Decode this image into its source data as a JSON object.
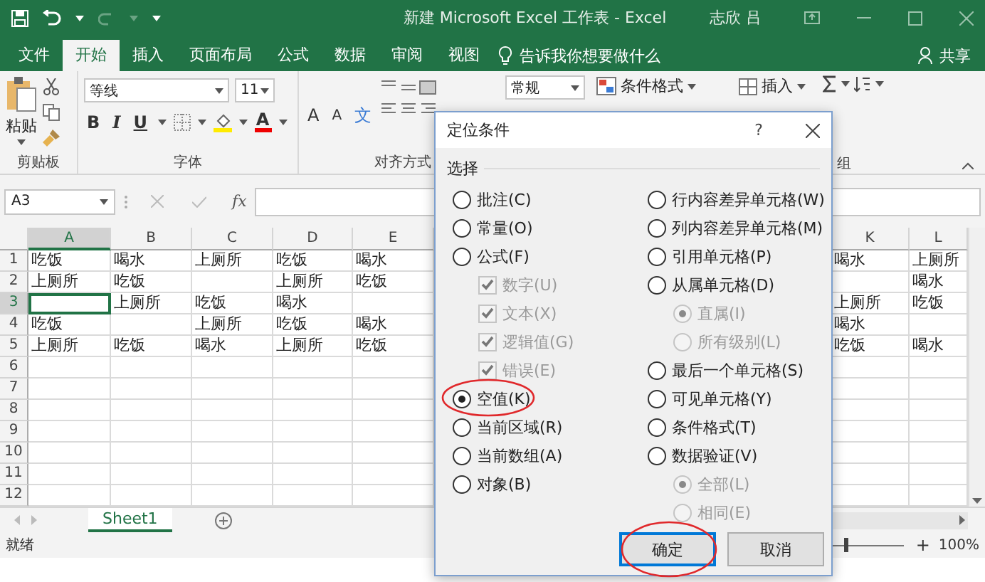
{
  "window": {
    "title": "新建 Microsoft Excel 工作表 - Excel",
    "user": "志欣 吕"
  },
  "ribbon_tabs": [
    {
      "label": "文件",
      "selected": false
    },
    {
      "label": "开始",
      "selected": true
    },
    {
      "label": "插入",
      "selected": false
    },
    {
      "label": "页面布局",
      "selected": false
    },
    {
      "label": "公式",
      "selected": false
    },
    {
      "label": "数据",
      "selected": false
    },
    {
      "label": "审阅",
      "selected": false
    },
    {
      "label": "视图",
      "selected": false
    }
  ],
  "tell_me": {
    "placeholder": "告诉我你想要做什么"
  },
  "share": "共享",
  "ribbon": {
    "paste": "粘贴",
    "font_name": "等线",
    "font_size": "11",
    "grow_font": "A",
    "shrink_font": "A",
    "font_styles": [
      "B",
      "I",
      "U"
    ],
    "font_color": "A",
    "phonetic": "文",
    "number_format": "常规",
    "conditional_format": "条件格式",
    "insert_cells": "插入",
    "group_labels": [
      "剪贴板",
      "字体",
      "对齐方式"
    ],
    "cut_label": "组"
  },
  "formula_bar": {
    "name_box": "A3",
    "function": "fx"
  },
  "sheet": {
    "columns": [
      {
        "label": "A",
        "selected": true
      },
      {
        "label": "B",
        "selected": false
      },
      {
        "label": "C",
        "selected": false
      },
      {
        "label": "D",
        "selected": false
      },
      {
        "label": "E",
        "selected": false
      }
    ],
    "right_columns": [
      "K",
      "L"
    ],
    "rows": [
      {
        "label": "1",
        "selected": false,
        "cells": [
          "吃饭",
          "喝水",
          "上厕所",
          "吃饭",
          "喝水"
        ],
        "right_cells": [
          "喝水",
          "上厕所"
        ]
      },
      {
        "label": "2",
        "selected": false,
        "cells": [
          "上厕所",
          "吃饭",
          null,
          "上厕所",
          "吃饭"
        ],
        "right_cells": [
          null,
          "喝水"
        ]
      },
      {
        "label": "3",
        "selected": true,
        "cells": [
          null,
          "上厕所",
          "吃饭",
          "喝水",
          null
        ],
        "right_cells": [
          "上厕所",
          "吃饭"
        ]
      },
      {
        "label": "4",
        "selected": false,
        "cells": [
          "吃饭",
          null,
          "上厕所",
          "吃饭",
          "喝水"
        ],
        "right_cells": [
          "喝水",
          null
        ]
      },
      {
        "label": "5",
        "selected": false,
        "cells": [
          "上厕所",
          "吃饭",
          "喝水",
          "上厕所",
          "吃饭"
        ],
        "right_cells": [
          "吃饭",
          "喝水"
        ]
      },
      {
        "label": "6",
        "selected": false
      },
      {
        "label": "7",
        "selected": false
      },
      {
        "label": "8",
        "selected": false
      },
      {
        "label": "9",
        "selected": false
      },
      {
        "label": "10",
        "selected": false
      },
      {
        "label": "11",
        "selected": false
      },
      {
        "label": "12",
        "selected": false
      }
    ]
  },
  "sheet_tabs": [
    {
      "label": "Sheet1",
      "selected": true
    }
  ],
  "status_bar": {
    "text": "就绪",
    "zoom_in": "+",
    "zoom": {
      "level": 0.5,
      "reading": "100%"
    }
  },
  "dialog": {
    "title": "定位条件",
    "help": "?",
    "group_label": "选择",
    "columns": [
      {
        "options": [
          {
            "kind": "radio",
            "label": "批注(C)",
            "selected": false,
            "disabled": false,
            "highlighted": false
          },
          {
            "kind": "radio",
            "label": "常量(O)",
            "selected": false,
            "disabled": false,
            "highlighted": false
          },
          {
            "kind": "radio",
            "label": "公式(F)",
            "selected": false,
            "disabled": false,
            "highlighted": false,
            "children": [
              {
                "kind": "checkbox",
                "label": "数字(U)",
                "checked": true,
                "disabled": true
              },
              {
                "kind": "checkbox",
                "label": "文本(X)",
                "checked": true,
                "disabled": true
              },
              {
                "kind": "checkbox",
                "label": "逻辑值(G)",
                "checked": true,
                "disabled": true
              },
              {
                "kind": "checkbox",
                "label": "错误(E)",
                "checked": true,
                "disabled": true
              }
            ]
          },
          {
            "kind": "radio",
            "label": "空值(K)",
            "selected": true,
            "disabled": false,
            "highlighted": true
          },
          {
            "kind": "radio",
            "label": "当前区域(R)",
            "selected": false,
            "disabled": false,
            "highlighted": false
          },
          {
            "kind": "radio",
            "label": "当前数组(A)",
            "selected": false,
            "disabled": false,
            "highlighted": false
          },
          {
            "kind": "radio",
            "label": "对象(B)",
            "selected": false,
            "disabled": false,
            "highlighted": false
          }
        ]
      },
      {
        "options": [
          {
            "kind": "radio",
            "label": "行内容差异单元格(W)",
            "selected": false,
            "disabled": false,
            "highlighted": false
          },
          {
            "kind": "radio",
            "label": "列内容差异单元格(M)",
            "selected": false,
            "disabled": false,
            "highlighted": false
          },
          {
            "kind": "radio",
            "label": "引用单元格(P)",
            "selected": false,
            "disabled": false,
            "highlighted": false
          },
          {
            "kind": "radio",
            "label": "从属单元格(D)",
            "selected": false,
            "disabled": false,
            "highlighted": false,
            "children": [
              {
                "kind": "radio",
                "label": "直属(I)",
                "selected": true,
                "disabled": true
              },
              {
                "kind": "radio",
                "label": "所有级别(L)",
                "selected": false,
                "disabled": true
              }
            ]
          },
          {
            "kind": "radio",
            "label": "最后一个单元格(S)",
            "selected": false,
            "disabled": false,
            "highlighted": false
          },
          {
            "kind": "radio",
            "label": "可见单元格(Y)",
            "selected": false,
            "disabled": false,
            "highlighted": false
          },
          {
            "kind": "radio",
            "label": "条件格式(T)",
            "selected": false,
            "disabled": false,
            "highlighted": false
          },
          {
            "kind": "radio",
            "label": "数据验证(V)",
            "selected": false,
            "disabled": false,
            "highlighted": false,
            "children": [
              {
                "kind": "radio",
                "label": "全部(L)",
                "selected": true,
                "disabled": true
              },
              {
                "kind": "radio",
                "label": "相同(E)",
                "selected": false,
                "disabled": true
              }
            ]
          }
        ]
      }
    ],
    "buttons": [
      {
        "label": "确定",
        "default": true,
        "highlighted": true
      },
      {
        "label": "取消",
        "default": false,
        "highlighted": false
      }
    ]
  }
}
